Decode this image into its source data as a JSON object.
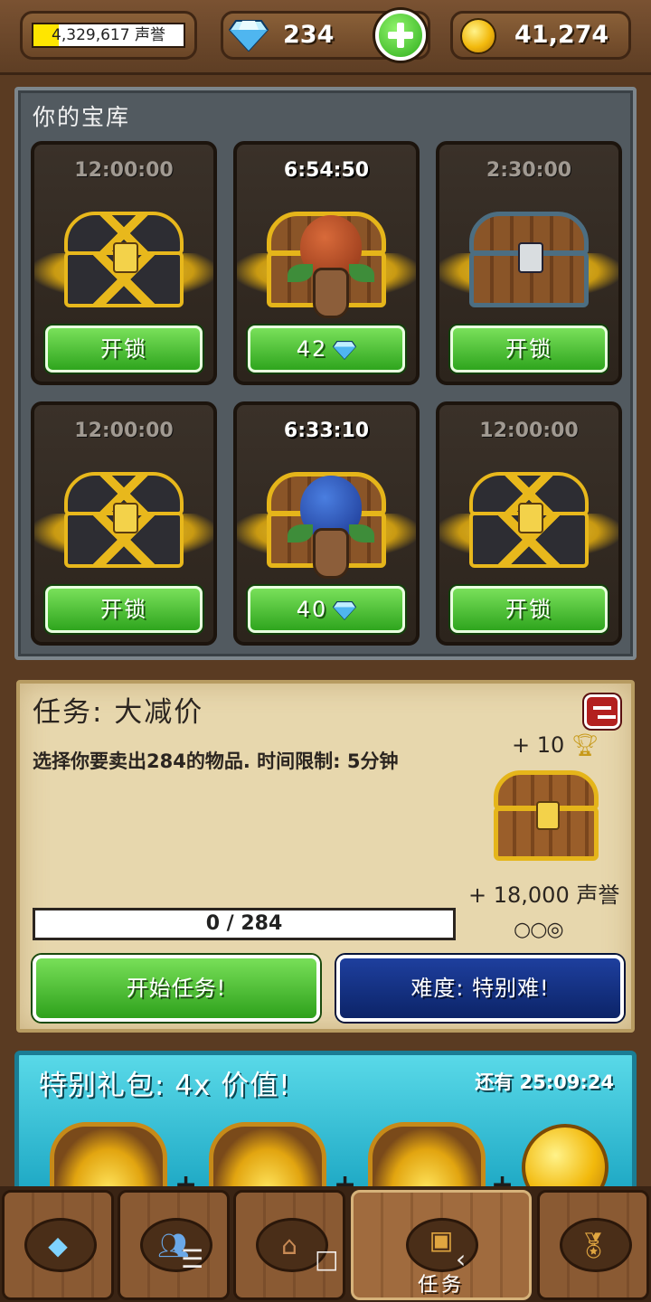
{
  "header": {
    "reputation_text": "4,329,617 声誉",
    "reputation_fill": 0.17,
    "gems": "234",
    "gold": "41,274"
  },
  "vault": {
    "title": "你的宝库",
    "slots": [
      {
        "timer": "12:00:00",
        "button": "开锁",
        "state": "idle",
        "chest": "fancy"
      },
      {
        "timer": "6:54:50",
        "button": "42",
        "state": "active",
        "chest": "mushroom-red",
        "gem_icon": "diamond-icon"
      },
      {
        "timer": "2:30:00",
        "button": "开锁",
        "state": "idle",
        "chest": "wood"
      },
      {
        "timer": "12:00:00",
        "button": "开锁",
        "state": "idle",
        "chest": "fancy"
      },
      {
        "timer": "6:33:10",
        "button": "40",
        "state": "active",
        "chest": "mushroom-blue",
        "gem_icon": "diamond-icon"
      },
      {
        "timer": "12:00:00",
        "button": "开锁",
        "state": "idle",
        "chest": "fancy"
      }
    ]
  },
  "quest": {
    "title": "任务: 大减价",
    "description": "选择你要卖出284的物品. 时间限制: 5分钟",
    "reward_trophy": "+ 10",
    "reward_reputation": "+ 18,000 声誉",
    "difficulty_dots": "○○◎",
    "progress_text": "0 / 284",
    "progress_fraction": 0,
    "start_button": "开始任务!",
    "difficulty_button": "难度: 特别难!"
  },
  "offer": {
    "title": "特别礼包:  4x 价值!",
    "timer": "还有 25:09:24",
    "plus": "+"
  },
  "bottom_nav": {
    "tabs": [
      {
        "name": "gems-tab",
        "icon": "diamond-icon",
        "label": ""
      },
      {
        "name": "friends-tab",
        "icon": "people-icon",
        "label": ""
      },
      {
        "name": "town-tab",
        "icon": "house-icon",
        "label": ""
      },
      {
        "name": "quests-tab",
        "icon": "chest-icon",
        "label": "任务",
        "active": true
      },
      {
        "name": "achievements-tab",
        "icon": "medal-icon",
        "label": ""
      }
    ]
  },
  "colors": {
    "accent_green": "#2fa51e",
    "accent_blue": "#0c2468",
    "gold": "#f2b90c"
  }
}
